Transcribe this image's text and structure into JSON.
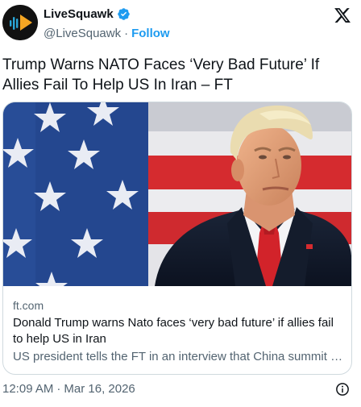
{
  "author": {
    "display_name": "LiveSquawk",
    "handle": "@LiveSquawk",
    "separator": "·",
    "follow_label": "Follow",
    "verified": true,
    "avatar_icon": "livesquawk-play-logo-icon"
  },
  "tweet": {
    "text": "Trump Warns NATO Faces ‘Very Bad Future’ If Allies Fail To Help US In Iran – FT"
  },
  "card": {
    "domain": "ft.com",
    "title": "Donald Trump warns Nato faces ‘very bad future’ if allies fail to help US in Iran",
    "description": "US president tells the FT in an interview that China summit c..."
  },
  "footer": {
    "time": "12:09 AM",
    "separator": "·",
    "date": "Mar 16, 2026",
    "info_icon": "info-circle-icon"
  },
  "colors": {
    "link": "#1d9bf0",
    "secondary_text": "#536471",
    "primary_text": "#0f1419",
    "border": "#cfd9de",
    "avatar_bg": "#111111",
    "logo_orange": "#f5a623",
    "logo_blue": "#2aa6d8"
  }
}
